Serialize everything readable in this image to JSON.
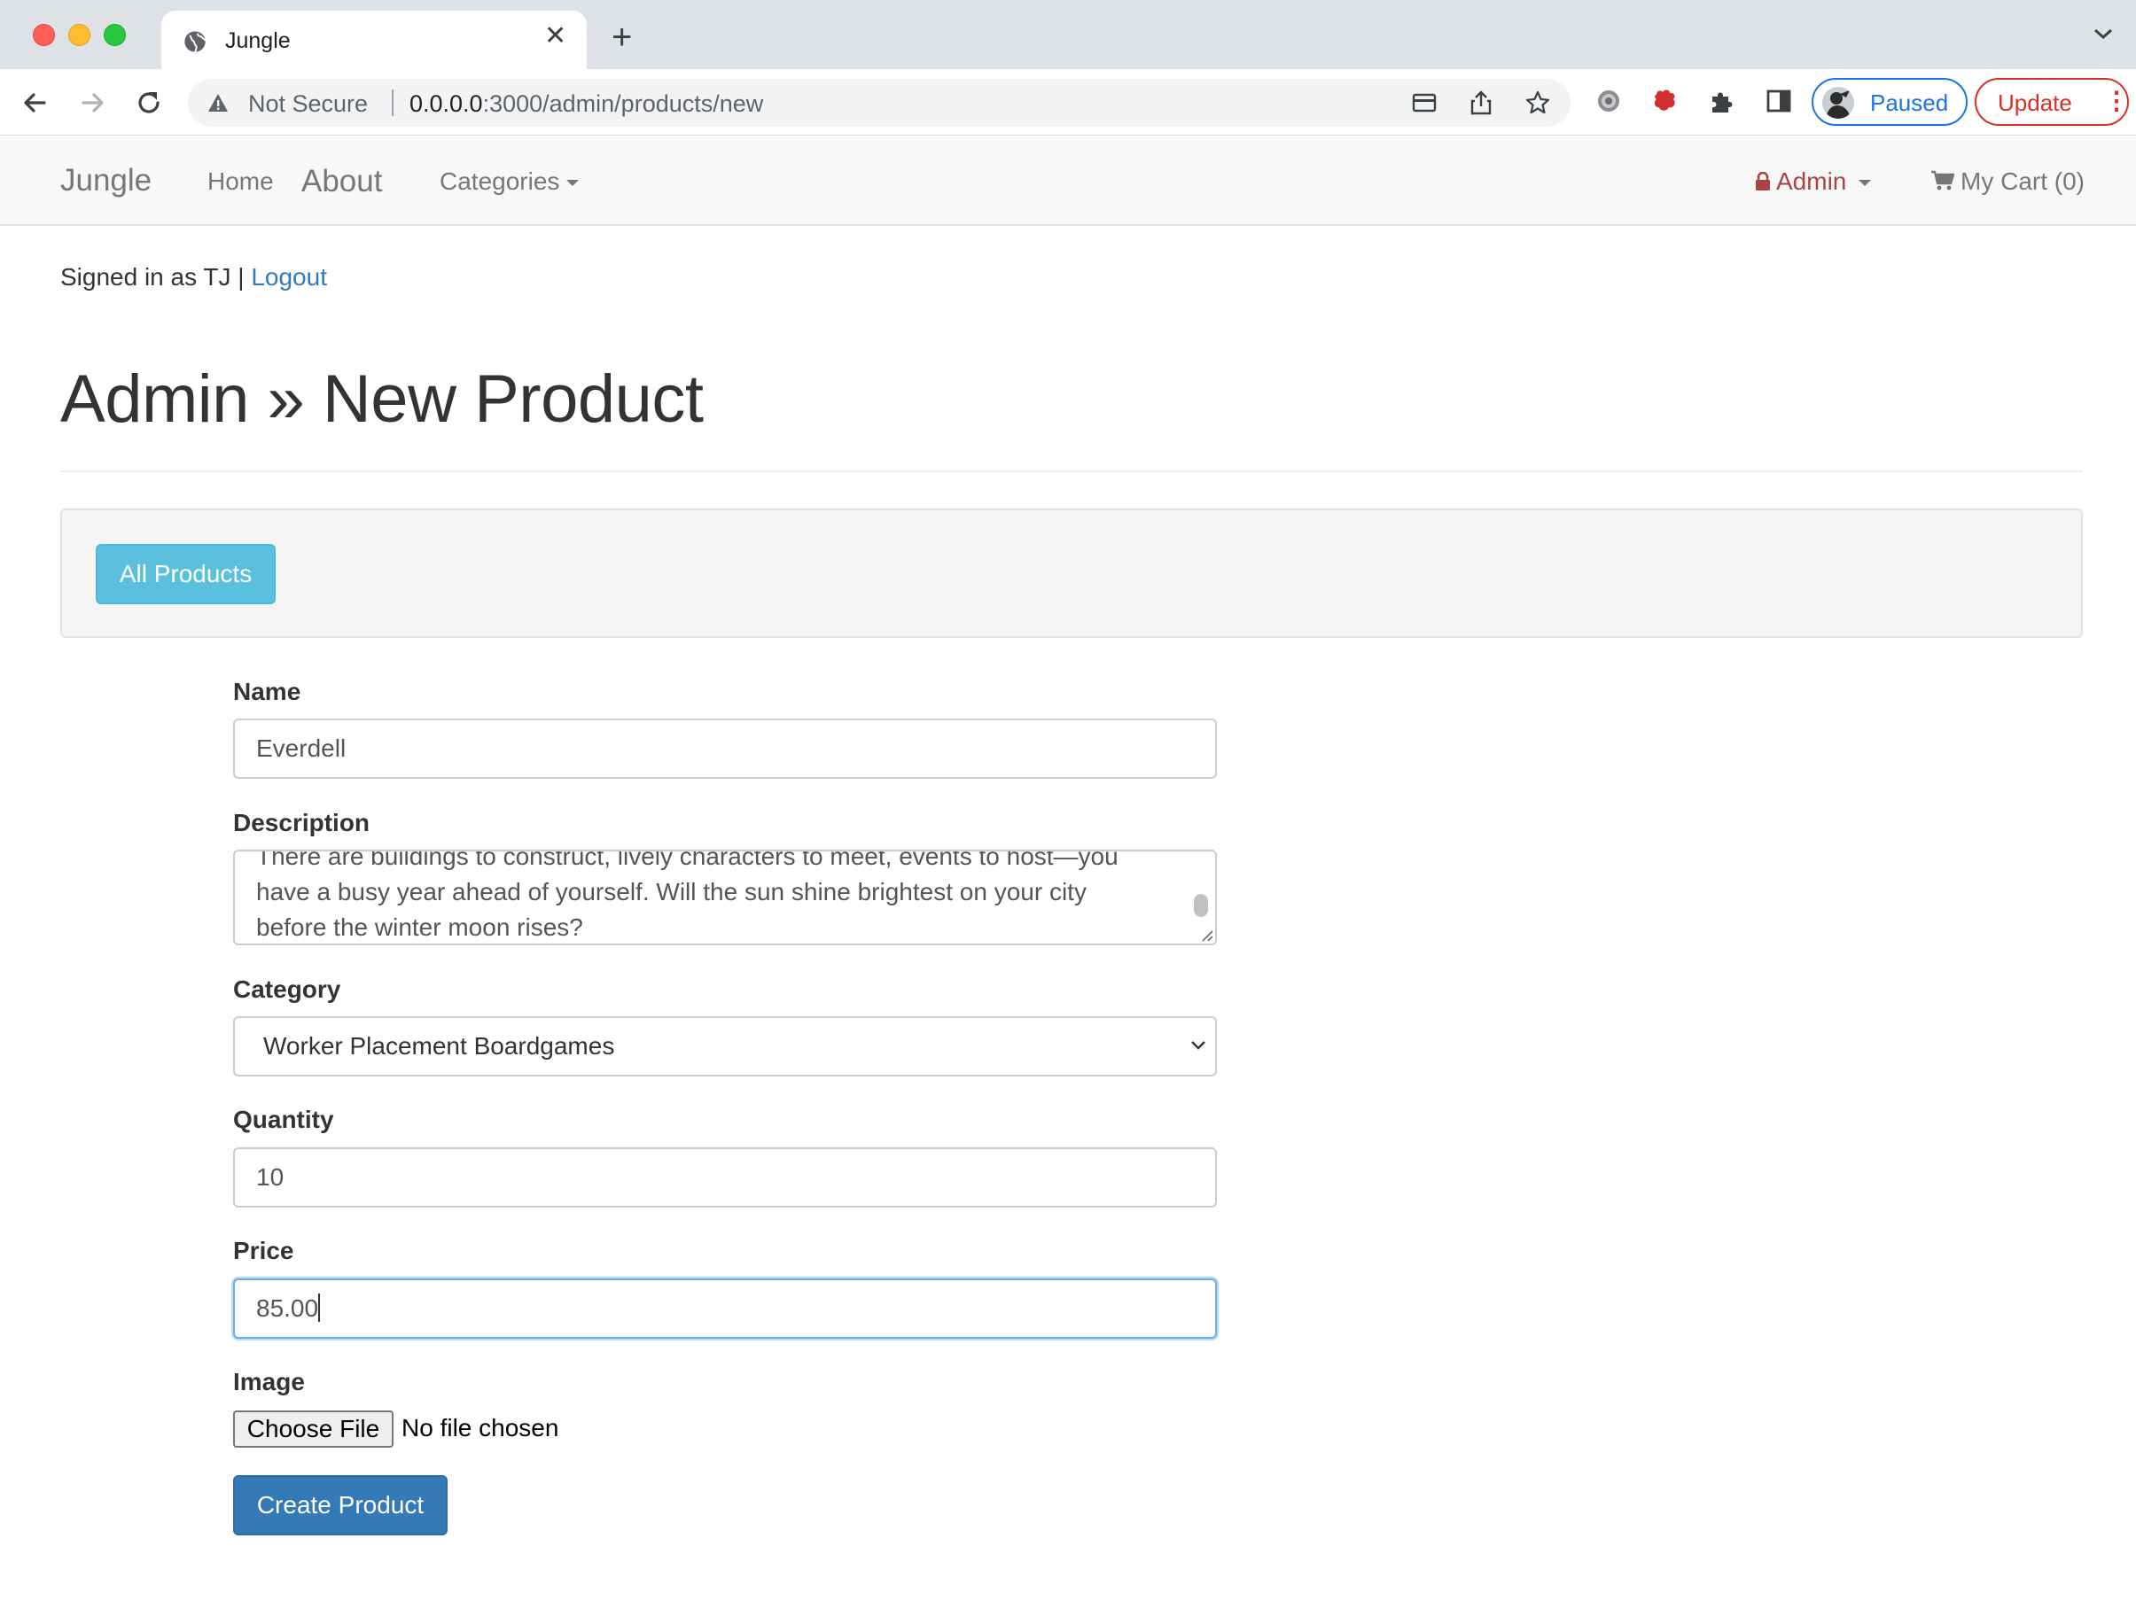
{
  "browser": {
    "tab_title": "Jungle",
    "security_label": "Not Secure",
    "url_host": "0.0.0.0",
    "url_rest": ":3000/admin/products/new",
    "profile_label": "Paused",
    "update_label": "Update",
    "accent_color": "#1a73e8",
    "update_color": "#d93025"
  },
  "navbar": {
    "brand": "Jungle",
    "home": "Home",
    "about": "About",
    "categories": "Categories",
    "admin": "Admin",
    "cart": "My Cart (0)"
  },
  "session": {
    "signed_in_text": "Signed in as TJ | ",
    "logout": "Logout"
  },
  "page": {
    "title": "Admin » New Product",
    "all_products_button": "All Products"
  },
  "form": {
    "name_label": "Name",
    "name_value": "Everdell",
    "description_label": "Description",
    "description_value": "There are buildings to construct, lively characters to meet, events to host—you have a busy year ahead of yourself. Will the sun shine brightest on your city before the winter moon rises?",
    "category_label": "Category",
    "category_value": "Worker Placement Boardgames",
    "quantity_label": "Quantity",
    "quantity_value": "10",
    "price_label": "Price",
    "price_value": "85.00",
    "image_label": "Image",
    "file_button": "Choose File",
    "file_status": "No file chosen",
    "submit": "Create Product"
  },
  "colors": {
    "link": "#337ab7",
    "info_button": "#5bc0de",
    "primary_button": "#337ab7",
    "admin_link": "#a94442"
  }
}
